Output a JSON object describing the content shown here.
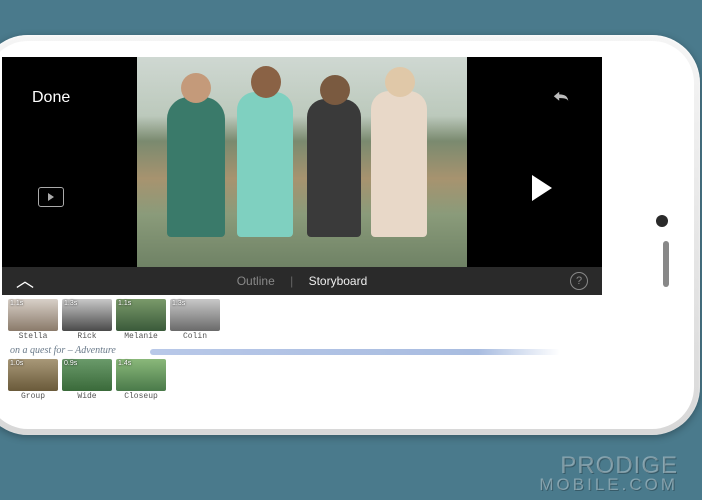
{
  "header": {
    "done_label": "Done"
  },
  "toolbar": {
    "outline_label": "Outline",
    "storyboard_label": "Storyboard",
    "help_label": "?"
  },
  "storyboard": {
    "row1": [
      {
        "duration": "1.1s",
        "label": "Stella"
      },
      {
        "duration": "1.3s",
        "label": "Rick"
      },
      {
        "duration": "1.1s",
        "label": "Melanie"
      },
      {
        "duration": "1.3s",
        "label": "Colin"
      }
    ],
    "tagline": "on a quest for – Adventure",
    "row2": [
      {
        "duration": "1.0s",
        "label": "Group"
      },
      {
        "duration": "0.9s",
        "label": "Wide"
      },
      {
        "duration": "1.4s",
        "label": "Closeup"
      }
    ]
  },
  "watermark": {
    "line1": "PRODIGE",
    "line2": "MOBILE.COM"
  }
}
